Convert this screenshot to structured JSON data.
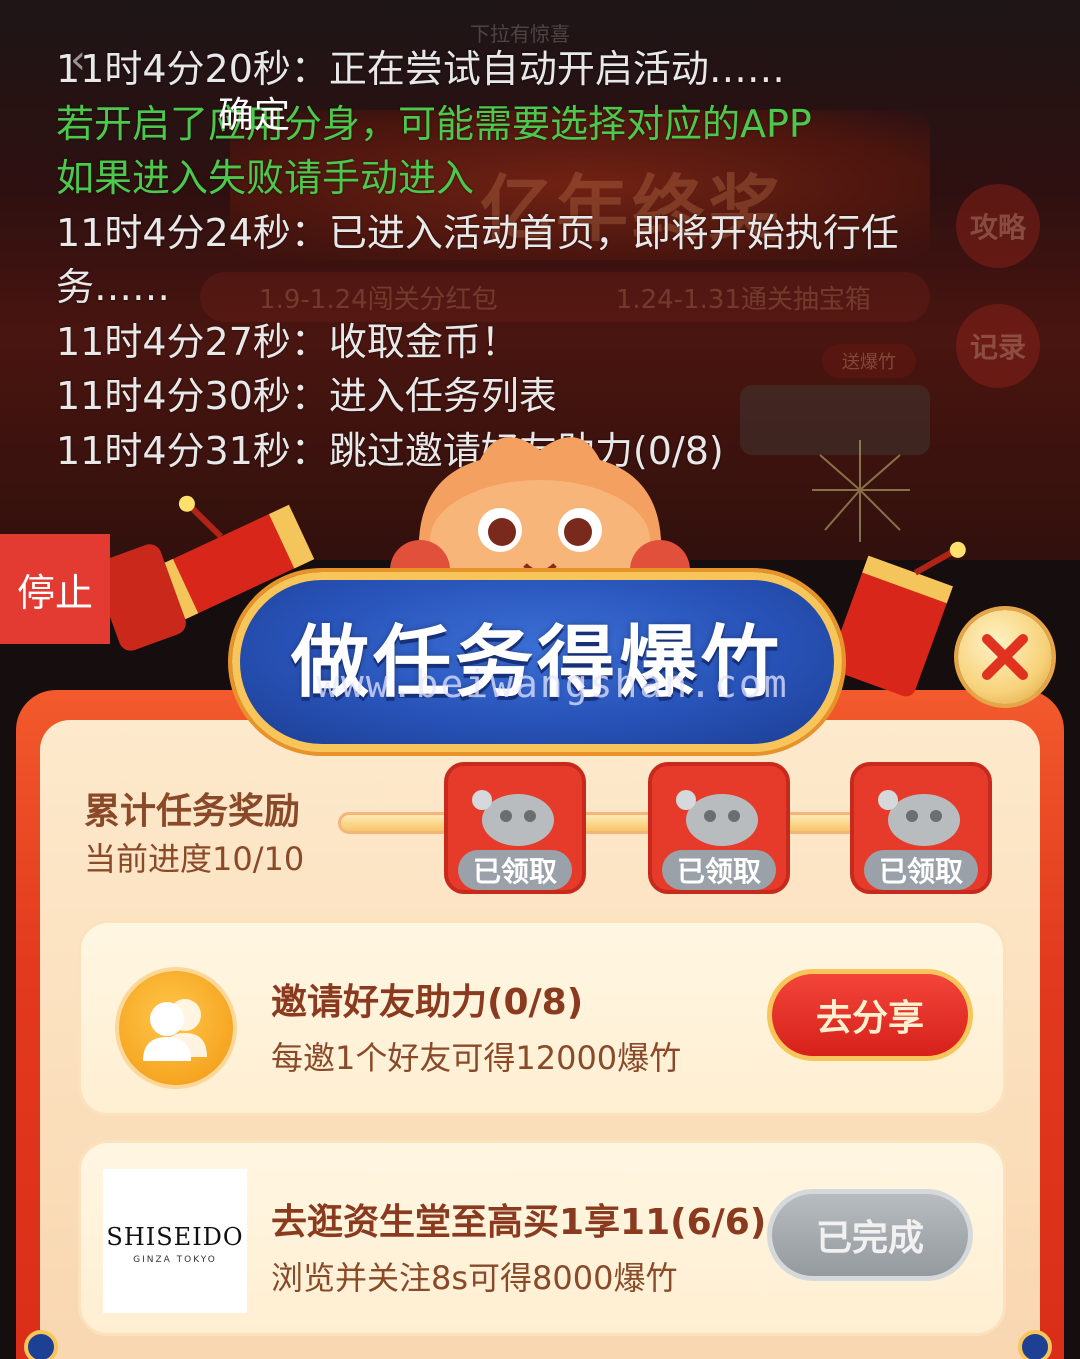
{
  "background": {
    "top_hint": "下拉有惊喜",
    "banner_text": "亿年终奖",
    "subtabs": [
      "1.9-1.24闯关分红包",
      "1.24-1.31通关抽宝箱"
    ],
    "side_buttons": [
      "攻略",
      "记录"
    ],
    "chip": "送爆竹"
  },
  "overlay": {
    "confirm_label": "确定",
    "log": [
      {
        "text": "11时4分20秒：正在尝试自动开启活动……",
        "color": "white"
      },
      {
        "text": "若开启了应用分身，可能需要选择对应的APP",
        "color": "green"
      },
      {
        "text": "如果进入失败请手动进入",
        "color": "green"
      },
      {
        "text": "11时4分24秒：已进入活动首页，即将开始执行任",
        "color": "white"
      },
      {
        "text": "务……",
        "color": "white"
      },
      {
        "text": "11时4分27秒：收取金币！",
        "color": "white"
      },
      {
        "text": "11时4分30秒：进入任务列表",
        "color": "white"
      },
      {
        "text": "11时4分31秒：跳过邀请好友助力(0/8)",
        "color": "white"
      }
    ],
    "stop_label": "停止"
  },
  "modal": {
    "title": "做任务得爆竹",
    "watermark": "www.beiwangshan.com",
    "progress": {
      "title": "累计任务奖励",
      "subtitle": "当前进度10/10",
      "fraction": 1.0,
      "rewards": [
        {
          "label": "已领取"
        },
        {
          "label": "已领取"
        },
        {
          "label": "已领取"
        }
      ]
    },
    "tasks": [
      {
        "title": "邀请好友助力(0/8)",
        "desc": "每邀1个好友可得12000爆竹",
        "button": "去分享",
        "state": "active",
        "icon": "friends-icon"
      },
      {
        "title": "去逛资生堂至高买1享11(6/6)",
        "desc": "浏览并关注8s可得8000爆竹",
        "button": "已完成",
        "state": "done",
        "logo_main": "SHISEIDO",
        "logo_sub": "GINZA TOKYO"
      }
    ]
  },
  "colors": {
    "log_green": "#4cc94c",
    "stop_red": "#e33b32",
    "modal_red": "#e23a1e",
    "title_blue": "#2853b8",
    "button_red": "#d6211a",
    "done_gray": "#959a9f"
  }
}
